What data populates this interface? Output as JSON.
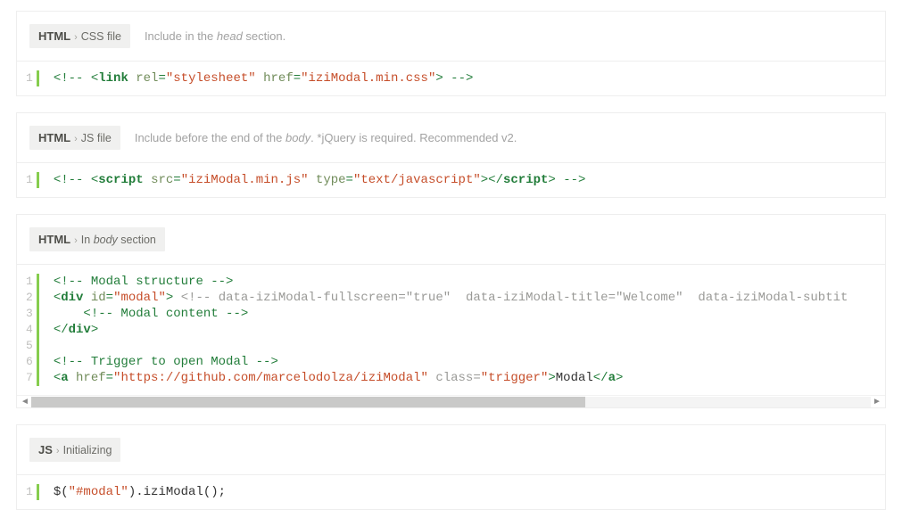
{
  "blocks": [
    {
      "lang": "HTML",
      "sub": "CSS file",
      "note_html": "Include in the <em>head</em> section.",
      "has_scrollbar": false,
      "lines": [
        [
          {
            "cls": "pun",
            "t": "<!--"
          },
          {
            "cls": "plain",
            "t": " "
          },
          {
            "cls": "pun",
            "t": "<"
          },
          {
            "cls": "tag",
            "t": "link"
          },
          {
            "cls": "plain",
            "t": " "
          },
          {
            "cls": "attr",
            "t": "rel"
          },
          {
            "cls": "pun",
            "t": "="
          },
          {
            "cls": "str",
            "t": "\"stylesheet\""
          },
          {
            "cls": "plain",
            "t": " "
          },
          {
            "cls": "attr",
            "t": "href"
          },
          {
            "cls": "pun",
            "t": "="
          },
          {
            "cls": "str",
            "t": "\"iziModal.min.css\""
          },
          {
            "cls": "pun",
            "t": ">"
          },
          {
            "cls": "plain",
            "t": " "
          },
          {
            "cls": "pun",
            "t": "-->"
          }
        ]
      ]
    },
    {
      "lang": "HTML",
      "sub": "JS file",
      "note_html": "Include before the end of the <em>body</em>. *jQuery is required. Recommended v2.",
      "has_scrollbar": false,
      "lines": [
        [
          {
            "cls": "pun",
            "t": "<!--"
          },
          {
            "cls": "plain",
            "t": " "
          },
          {
            "cls": "pun",
            "t": "<"
          },
          {
            "cls": "tag",
            "t": "script"
          },
          {
            "cls": "plain",
            "t": " "
          },
          {
            "cls": "attr",
            "t": "src"
          },
          {
            "cls": "pun",
            "t": "="
          },
          {
            "cls": "str",
            "t": "\"iziModal.min.js\""
          },
          {
            "cls": "plain",
            "t": " "
          },
          {
            "cls": "attr",
            "t": "type"
          },
          {
            "cls": "pun",
            "t": "="
          },
          {
            "cls": "str",
            "t": "\"text/javascript\""
          },
          {
            "cls": "pun",
            "t": "></"
          },
          {
            "cls": "tag",
            "t": "script"
          },
          {
            "cls": "pun",
            "t": ">"
          },
          {
            "cls": "plain",
            "t": " "
          },
          {
            "cls": "pun",
            "t": "-->"
          }
        ]
      ]
    },
    {
      "lang": "HTML",
      "sub_html": "In <em>body</em> section",
      "note_html": "",
      "has_scrollbar": true,
      "lines": [
        [
          {
            "cls": "cmt",
            "t": "<!-- Modal structure -->"
          }
        ],
        [
          {
            "cls": "pun",
            "t": "<"
          },
          {
            "cls": "tag",
            "t": "div"
          },
          {
            "cls": "plain",
            "t": " "
          },
          {
            "cls": "attr",
            "t": "id"
          },
          {
            "cls": "pun",
            "t": "="
          },
          {
            "cls": "str",
            "t": "\"modal\""
          },
          {
            "cls": "pun",
            "t": ">"
          },
          {
            "cls": "plain",
            "t": " "
          },
          {
            "cls": "grey",
            "t": "<!-- data-iziModal-fullscreen=\"true\"  data-iziModal-title=\"Welcome\"  data-iziModal-subtit"
          }
        ],
        [
          {
            "cls": "plain",
            "t": "    "
          },
          {
            "cls": "cmt",
            "t": "<!-- Modal content -->"
          }
        ],
        [
          {
            "cls": "pun",
            "t": "</"
          },
          {
            "cls": "tag",
            "t": "div"
          },
          {
            "cls": "pun",
            "t": ">"
          }
        ],
        [
          {
            "cls": "plain",
            "t": ""
          }
        ],
        [
          {
            "cls": "cmt",
            "t": "<!-- Trigger to open Modal -->"
          }
        ],
        [
          {
            "cls": "pun",
            "t": "<"
          },
          {
            "cls": "tag",
            "t": "a"
          },
          {
            "cls": "plain",
            "t": " "
          },
          {
            "cls": "attr",
            "t": "href"
          },
          {
            "cls": "pun",
            "t": "="
          },
          {
            "cls": "str",
            "t": "\"https://github.com/marcelodolza/iziModal\""
          },
          {
            "cls": "plain",
            "t": " "
          },
          {
            "cls": "grey",
            "t": "class="
          },
          {
            "cls": "str",
            "t": "\"trigger\""
          },
          {
            "cls": "pun",
            "t": ">"
          },
          {
            "cls": "plain",
            "t": "Modal"
          },
          {
            "cls": "pun",
            "t": "</"
          },
          {
            "cls": "tag",
            "t": "a"
          },
          {
            "cls": "pun",
            "t": ">"
          }
        ]
      ]
    },
    {
      "lang": "JS",
      "sub": "Initializing",
      "note_html": "",
      "has_scrollbar": false,
      "lines": [
        [
          {
            "cls": "plain",
            "t": "$("
          },
          {
            "cls": "str",
            "t": "\"#modal\""
          },
          {
            "cls": "plain",
            "t": ").iziModal();"
          }
        ]
      ]
    }
  ]
}
